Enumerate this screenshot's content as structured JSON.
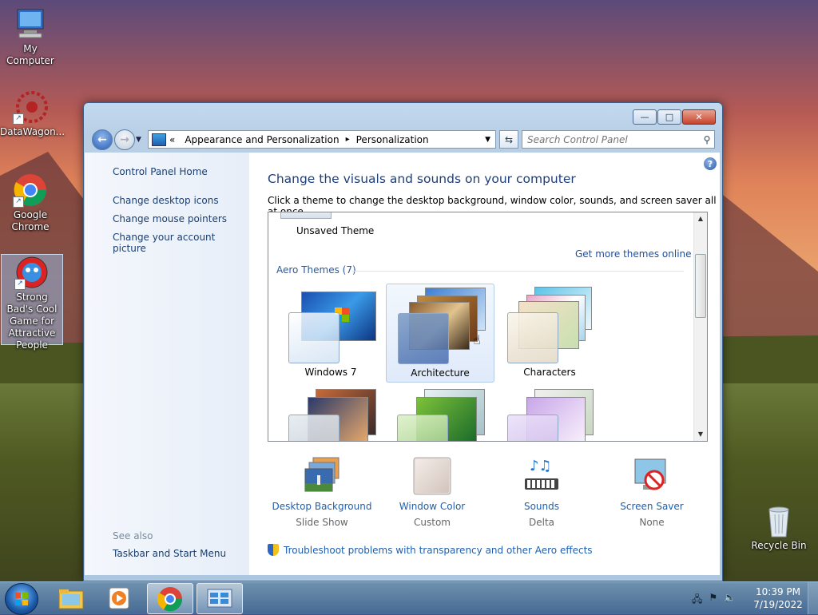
{
  "desktop": {
    "icons": [
      {
        "label": "My Computer",
        "icon": "computer-icon"
      },
      {
        "label": "DataWagon...",
        "icon": "datawagon-icon"
      },
      {
        "label": "Google Chrome",
        "icon": "chrome-icon"
      },
      {
        "label": "Strong Bad's Cool Game for Attractive People",
        "icon": "game-icon"
      },
      {
        "label": "Recycle Bin",
        "icon": "recycle-bin-icon"
      }
    ]
  },
  "window": {
    "caption_buttons": {
      "minimize": "—",
      "maximize": "□",
      "close": "✕"
    },
    "nav": {
      "back": "←",
      "forward": "→"
    },
    "address": {
      "prefix": "«",
      "crumbs": [
        "Appearance and Personalization",
        "Personalization"
      ],
      "separator": "▸"
    },
    "search_placeholder": "Search Control Panel",
    "left_pane": {
      "home": "Control Panel Home",
      "links": [
        "Change desktop icons",
        "Change mouse pointers",
        "Change your account picture"
      ],
      "see_also_label": "See also",
      "see_also_links": [
        "Taskbar and Start Menu"
      ]
    },
    "main": {
      "title": "Change the visuals and sounds on your computer",
      "description": "Click a theme to change the desktop background, window color, sounds, and screen saver all at once.",
      "unsaved_theme": "Unsaved Theme",
      "get_more": "Get more themes online",
      "aero_header": "Aero Themes (7)",
      "themes": [
        {
          "name": "Windows 7",
          "selected": false
        },
        {
          "name": "Architecture",
          "selected": true
        },
        {
          "name": "Characters",
          "selected": false
        }
      ],
      "bottom_items": [
        {
          "label": "Desktop Background",
          "sub": "Slide Show"
        },
        {
          "label": "Window Color",
          "sub": "Custom"
        },
        {
          "label": "Sounds",
          "sub": "Delta"
        },
        {
          "label": "Screen Saver",
          "sub": "None"
        }
      ],
      "troubleshoot": "Troubleshoot problems with transparency and other Aero effects"
    }
  },
  "taskbar": {
    "clock_time": "10:39 PM",
    "clock_date": "7/19/2022",
    "pinned": [
      "explorer-icon",
      "media-player-icon",
      "chrome-icon",
      "control-panel-icon"
    ]
  },
  "colors": {
    "link": "#1e5fb0",
    "title": "#1e3f7a",
    "accent": "#2a5aa0"
  }
}
